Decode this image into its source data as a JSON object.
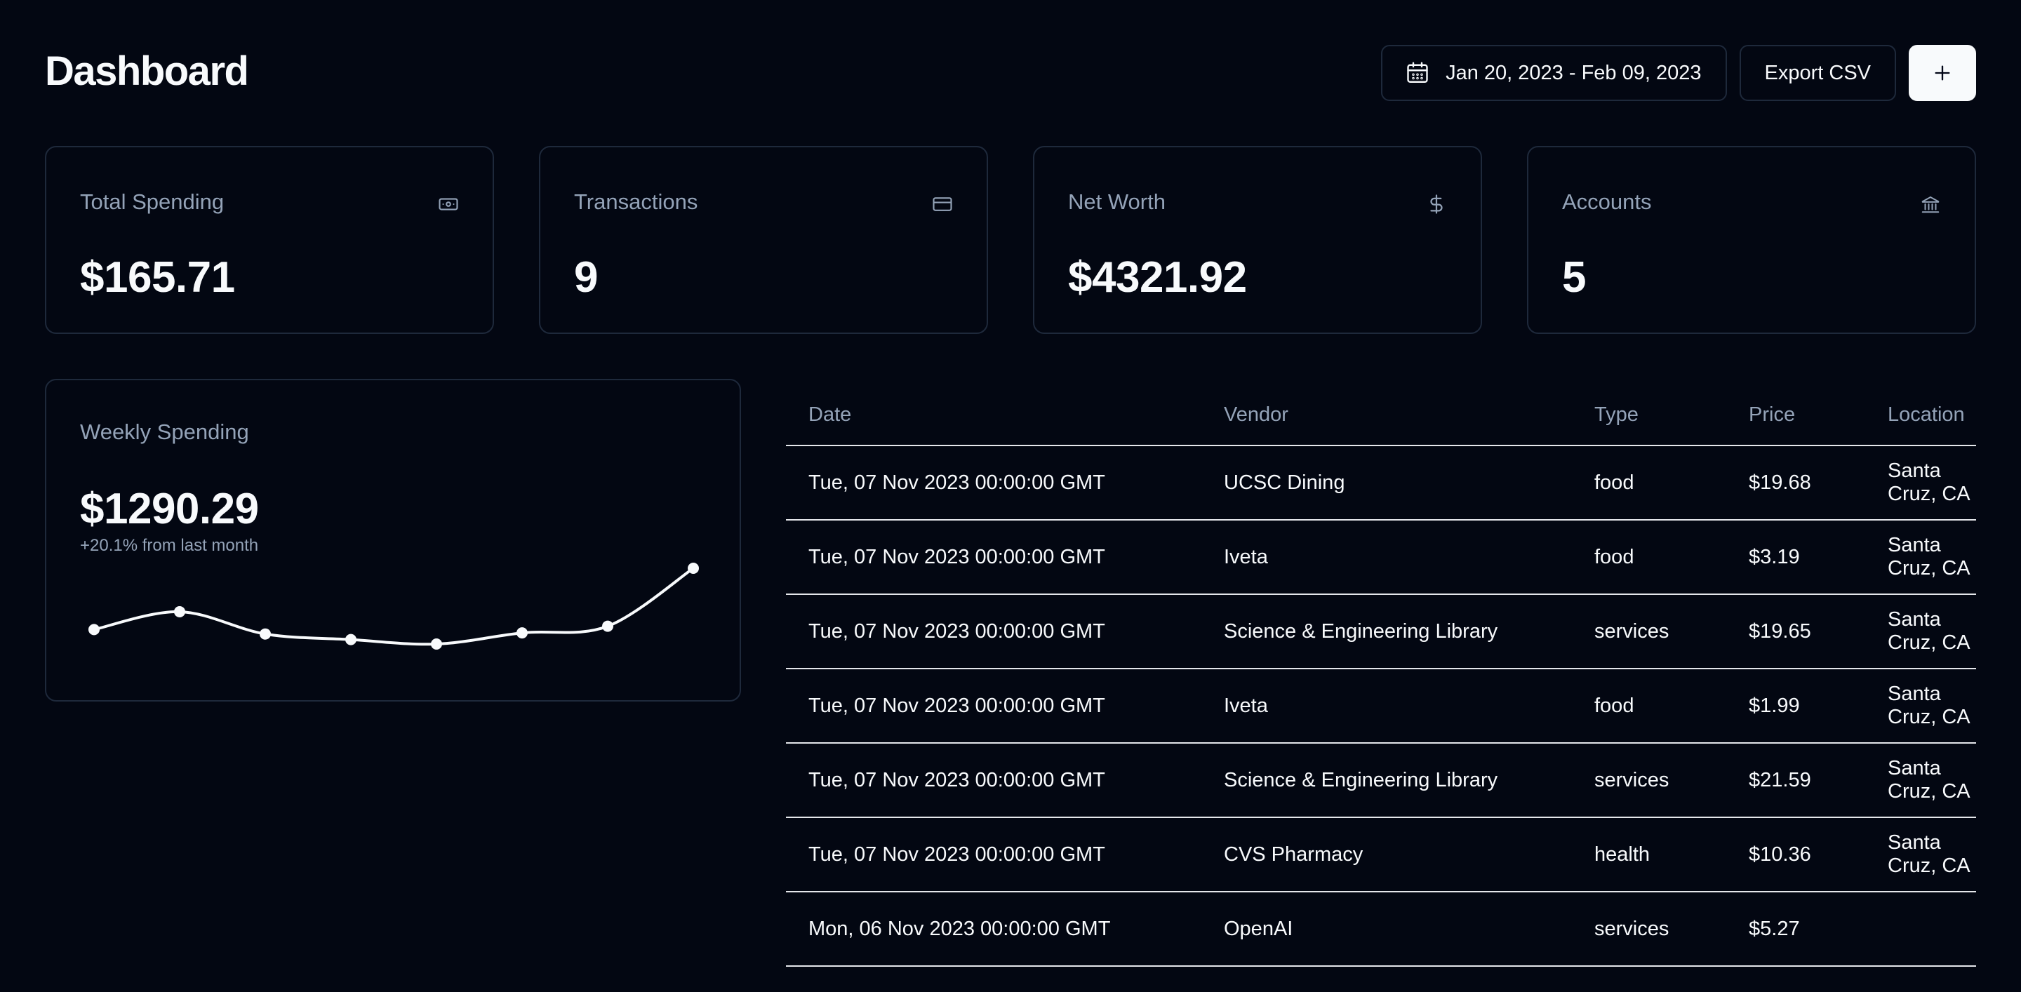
{
  "header": {
    "title": "Dashboard",
    "date_range": "Jan 20, 2023 - Feb 09, 2023",
    "export_label": "Export CSV",
    "add_label": "+"
  },
  "stats": [
    {
      "label": "Total Spending",
      "value": "$165.71",
      "icon": "banknote-icon"
    },
    {
      "label": "Transactions",
      "value": "9",
      "icon": "credit-card-icon"
    },
    {
      "label": "Net Worth",
      "value": "$4321.92",
      "icon": "dollar-sign-icon"
    },
    {
      "label": "Accounts",
      "value": "5",
      "icon": "bank-icon"
    }
  ],
  "weekly": {
    "label": "Weekly Spending",
    "value": "$1290.29",
    "sub": "+20.1% from last month",
    "trend_values": [
      150,
      182,
      142,
      132,
      124,
      144,
      156,
      260
    ]
  },
  "table": {
    "headers": [
      "Date",
      "Vendor",
      "Type",
      "Price",
      "Location"
    ],
    "rows": [
      [
        "Tue, 07 Nov 2023 00:00:00 GMT",
        "UCSC Dining",
        "food",
        "$19.68",
        "Santa Cruz, CA"
      ],
      [
        "Tue, 07 Nov 2023 00:00:00 GMT",
        "Iveta",
        "food",
        "$3.19",
        "Santa Cruz, CA"
      ],
      [
        "Tue, 07 Nov 2023 00:00:00 GMT",
        "Science & Engineering Library",
        "services",
        "$19.65",
        "Santa Cruz, CA"
      ],
      [
        "Tue, 07 Nov 2023 00:00:00 GMT",
        "Iveta",
        "food",
        "$1.99",
        "Santa Cruz, CA"
      ],
      [
        "Tue, 07 Nov 2023 00:00:00 GMT",
        "Science & Engineering Library",
        "services",
        "$21.59",
        "Santa Cruz, CA"
      ],
      [
        "Tue, 07 Nov 2023 00:00:00 GMT",
        "CVS Pharmacy",
        "health",
        "$10.36",
        "Santa Cruz, CA"
      ],
      [
        "Mon, 06 Nov 2023 00:00:00 GMT",
        "OpenAI",
        "services",
        "$5.27",
        ""
      ]
    ]
  },
  "colors": {
    "background": "#030712",
    "border": "#1e293b",
    "muted": "#94a3b8",
    "text": "#f8fafc"
  }
}
